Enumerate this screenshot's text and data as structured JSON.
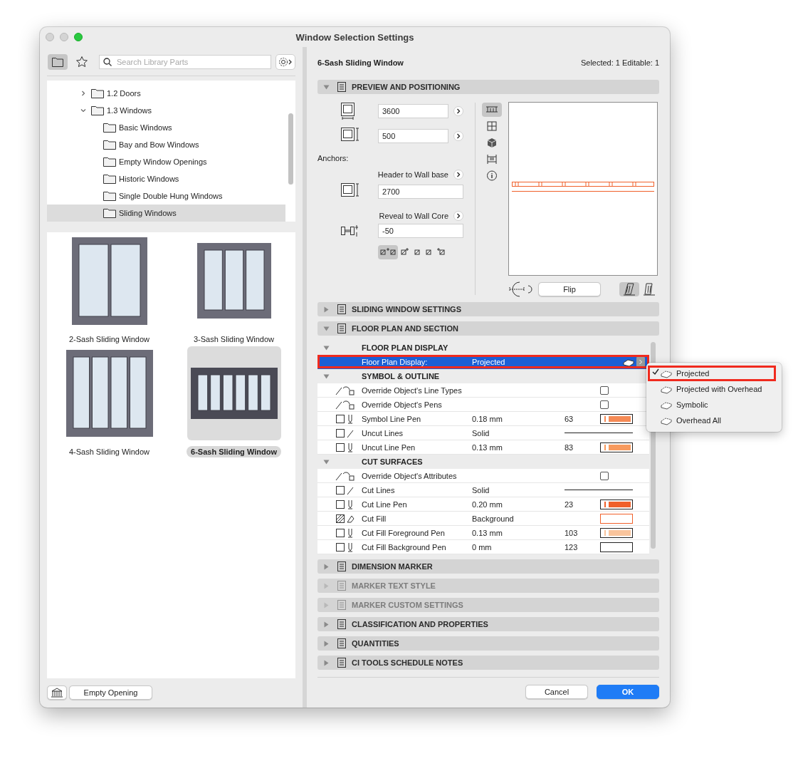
{
  "window": {
    "title": "Window Selection Settings"
  },
  "library": {
    "toolbar": {
      "folder_view": {
        "selected": true
      },
      "favorites": {
        "selected": false
      },
      "search": {
        "placeholder": "Search Library Parts"
      }
    },
    "tree": [
      {
        "label": "1.2 Doors",
        "expanded": false,
        "selected": false
      },
      {
        "label": "1.3 Windows",
        "expanded": true,
        "selected": false,
        "children": [
          {
            "label": "Basic Windows",
            "selected": false
          },
          {
            "label": "Bay and Bow Windows",
            "selected": false
          },
          {
            "label": "Empty Window Openings",
            "selected": false
          },
          {
            "label": "Historic Windows",
            "selected": false
          },
          {
            "label": "Single Double Hung Windows",
            "selected": false
          },
          {
            "label": "Sliding Windows",
            "selected": true
          }
        ]
      }
    ],
    "gallery": [
      {
        "label": "2-Sash Sliding Window",
        "kind": "two-sash",
        "selected": false
      },
      {
        "label": "3-Sash Sliding Window",
        "kind": "three-sash",
        "selected": false
      },
      {
        "label": "4-Sash Sliding Window",
        "kind": "four-sash",
        "selected": false
      },
      {
        "label": "6-Sash Sliding Window",
        "kind": "six-sash",
        "selected": true
      }
    ],
    "empty_opening_button": "Empty Opening"
  },
  "settings": {
    "title": "6-Sash Sliding Window",
    "selection_info": "Selected: 1 Editable: 1",
    "sections": [
      {
        "kind": "preview",
        "title": "PREVIEW AND POSITIONING",
        "expanded": true,
        "disabled": false,
        "width_value": "3600",
        "height_value": "500",
        "anchors_label": "Anchors:",
        "header_label": "Header to Wall base",
        "header_value": "2700",
        "reveal_label": "Reveal to Wall Core",
        "reveal_value": "-50",
        "anchor_buttons": [
          {
            "kind": "both",
            "selected": true
          },
          {
            "kind": "outer",
            "selected": false
          },
          {
            "kind": "core-outer",
            "selected": false
          },
          {
            "kind": "core-inner",
            "selected": false
          },
          {
            "kind": "inner",
            "selected": false
          }
        ],
        "view_buttons": [
          {
            "kind": "plan",
            "selected": true
          },
          {
            "kind": "elevation",
            "selected": false
          },
          {
            "kind": "model",
            "selected": false
          },
          {
            "kind": "section",
            "selected": false
          },
          {
            "kind": "info",
            "selected": false
          }
        ],
        "flip_button": "Flip",
        "mirror_buttons": [
          {
            "kind": "left",
            "selected": true
          },
          {
            "kind": "right",
            "selected": false
          }
        ]
      },
      {
        "kind": "plain",
        "title": "SLIDING WINDOW SETTINGS",
        "expanded": false,
        "disabled": false
      },
      {
        "kind": "table",
        "title": "FLOOR PLAN AND SECTION",
        "expanded": true,
        "disabled": false,
        "groups": [
          {
            "title": "FLOOR PLAN DISPLAY",
            "expanded": true,
            "rows": [
              {
                "kind": "select",
                "label": "Floor Plan Display:",
                "value": "Projected",
                "selected": true,
                "annotated": true
              }
            ]
          },
          {
            "title": "SYMBOL & OUTLINE",
            "expanded": true,
            "rows": [
              {
                "kind": "checkbox",
                "label": "Override Object's Line Types",
                "checked": false,
                "selected": false
              },
              {
                "kind": "checkbox",
                "label": "Override Object's Pens",
                "checked": false,
                "selected": false
              },
              {
                "kind": "pen",
                "label": "Symbol Line Pen",
                "value": "0.18 mm",
                "number": "63",
                "color": "#f58a55",
                "selected": false
              },
              {
                "kind": "line",
                "label": "Uncut Lines",
                "value": "Solid",
                "selected": false
              },
              {
                "kind": "pen",
                "label": "Uncut Line Pen",
                "value": "0.13 mm",
                "number": "83",
                "color": "#f79a5e",
                "selected": false
              }
            ]
          },
          {
            "title": "CUT SURFACES",
            "expanded": true,
            "rows": [
              {
                "kind": "checkbox",
                "label": "Override Object's Attributes",
                "checked": false,
                "selected": false
              },
              {
                "kind": "line",
                "label": "Cut Lines",
                "value": "Solid",
                "selected": false
              },
              {
                "kind": "pen",
                "label": "Cut Line Pen",
                "value": "0.20 mm",
                "number": "23",
                "color": "#f0602a",
                "selected": false
              },
              {
                "kind": "fill",
                "label": "Cut Fill",
                "value": "Background",
                "color": "#f0602a",
                "selected": false
              },
              {
                "kind": "pen",
                "label": "Cut Fill Foreground Pen",
                "value": "0.13 mm",
                "number": "103",
                "color": "#f9c49c",
                "selected": false
              },
              {
                "kind": "pen",
                "label": "Cut Fill Background Pen",
                "value": "0 mm",
                "number": "123",
                "color": "#ffffff",
                "selected": false
              }
            ]
          }
        ]
      },
      {
        "kind": "plain",
        "title": "DIMENSION MARKER",
        "expanded": false,
        "disabled": false
      },
      {
        "kind": "plain",
        "title": "MARKER TEXT STYLE",
        "expanded": false,
        "disabled": true
      },
      {
        "kind": "plain",
        "title": "MARKER CUSTOM SETTINGS",
        "expanded": false,
        "disabled": true
      },
      {
        "kind": "plain",
        "title": "CLASSIFICATION AND PROPERTIES",
        "expanded": false,
        "disabled": false
      },
      {
        "kind": "plain",
        "title": "QUANTITIES",
        "expanded": false,
        "disabled": false
      },
      {
        "kind": "plain",
        "title": "CI TOOLS SCHEDULE NOTES",
        "expanded": false,
        "disabled": false
      }
    ],
    "footer": {
      "cancel": "Cancel",
      "ok": "OK"
    }
  },
  "popup_menu": {
    "items": [
      {
        "label": "Projected",
        "selected": true,
        "annotated": true
      },
      {
        "label": "Projected with Overhead",
        "selected": false,
        "annotated": false
      },
      {
        "label": "Symbolic",
        "selected": false,
        "annotated": false
      },
      {
        "label": "Overhead All",
        "selected": false,
        "annotated": false
      }
    ]
  }
}
